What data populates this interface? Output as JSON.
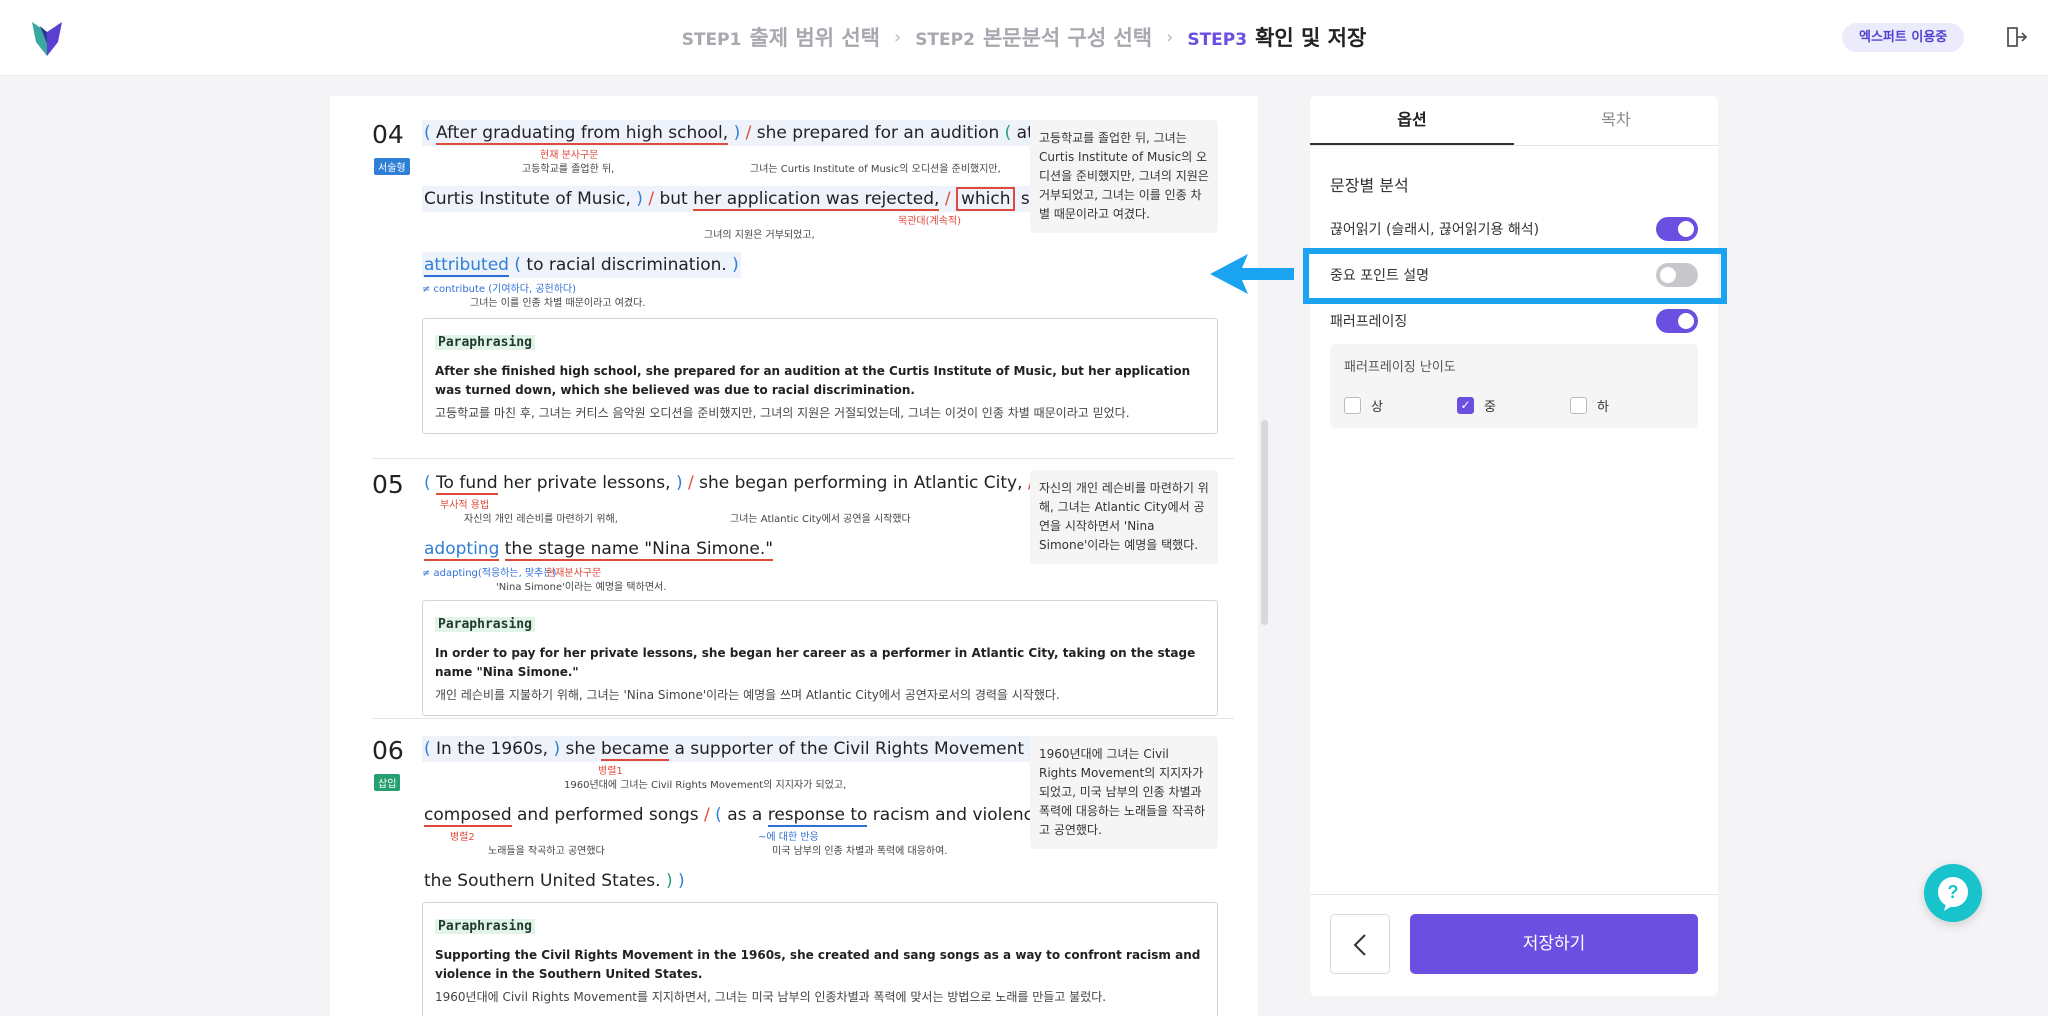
{
  "steps": [
    {
      "num": "STEP1",
      "name": "출제 범위 선택"
    },
    {
      "num": "STEP2",
      "name": "본문분석 구성 선택"
    },
    {
      "num": "STEP3",
      "name": "확인 및 저장"
    }
  ],
  "header": {
    "badge": "엑스퍼트 이용중"
  },
  "items": {
    "q04": {
      "num": "04",
      "tag": "서술형",
      "l1": {
        "ann_a": "현재 분사구문",
        "ann_b": "고등학교를 졸업한 뒤,",
        "ann_c": "그녀는 Curtis Institute of Music의 오디션을 준비했지만,"
      },
      "l2": {
        "ann_a": "그녀의 지원은 거부되었고,",
        "ann_b": "목관대(계속적)"
      },
      "l3": {
        "ann_a": "≠ contribute (기여하다, 공헌하다)",
        "ann_b": "그녀는 이를 인종 차별 때문이라고 여겼다."
      },
      "trans": "고등학교를 졸업한 뒤, 그녀는 Curtis Institute of Music의 오디션을 준비했지만, 그녀의 지원은 거부되었고, 그녀는 이를 인종 차별 때문이라고 여겼다.",
      "para_label": "Paraphrasing",
      "para_en": "After she finished high school, she prepared for an audition at the Curtis Institute of Music, but her application was turned down, which she believed was due to racial discrimination.",
      "para_ko": "고등학교를 마친 후, 그녀는 커티스 음악원 오디션을 준비했지만, 그녀의 지원은 거절되었는데, 그녀는 이것이 인종 차별 때문이라고 믿었다."
    },
    "q05": {
      "num": "05",
      "l1": {
        "ann_a": "부사적 용법",
        "ann_b": "자신의 개인 레슨비를 마련하기 위해,",
        "ann_c": "그녀는 Atlantic City에서 공연을 시작했다"
      },
      "l2": {
        "ann_a": "≠ adapting(적응하는, 맞추는)",
        "ann_b": "현재분사구문",
        "ann_c": "'Nina Simone'이라는 예명을 택하면서."
      },
      "trans": "자신의 개인 레슨비를 마련하기 위해, 그녀는 Atlantic City에서 공연을 시작하면서 'Nina Simone'이라는 예명을 택했다.",
      "para_label": "Paraphrasing",
      "para_en": "In order to pay for her private lessons, she began her career as a performer in Atlantic City, taking on the stage name \"Nina Simone.\"",
      "para_ko": "개인 레슨비를 지불하기 위해, 그녀는 'Nina Simone'이라는 예명을 쓰며 Atlantic City에서 공연자로서의 경력을 시작했다."
    },
    "q06": {
      "num": "06",
      "tag": "삽입",
      "l1": {
        "ann_a": "병렬1",
        "ann_b": "1960년대에 그녀는 Civil Rights Movement의 지지자가 되었고,"
      },
      "l2": {
        "ann_a": "병렬2",
        "ann_b": "노래들을 작곡하고 공연했다",
        "ann_c": "~에 대한 반응",
        "ann_d": "미국 남부의 인종 차별과 폭력에 대응하여."
      },
      "trans": "1960년대에 그녀는 Civil Rights Movement의 지지자가 되었고, 미국 남부의 인종 차별과 폭력에 대응하는 노래들을 작곡하고 공연했다.",
      "para_label": "Paraphrasing",
      "para_en": "Supporting the Civil Rights Movement in the 1960s, she created and sang songs as a way to confront racism and violence in the Southern United States.",
      "para_ko": "1960년대에 Civil Rights Movement를 지지하면서, 그녀는 미국 남부의 인종차별과 폭력에 맞서는 방법으로 노래를 만들고 불렀다."
    }
  },
  "panel": {
    "tabs": [
      "옵션",
      "목차"
    ],
    "section_title": "문장별 분석",
    "options": [
      {
        "label": "끊어읽기 (슬래시, 끊어읽기용 해석)",
        "on": true
      },
      {
        "label": "중요 포인트 설명",
        "on": false
      },
      {
        "label": "패러프레이징",
        "on": true
      }
    ],
    "difficulty": {
      "title": "패러프레이징 난이도",
      "levels": [
        {
          "label": "상",
          "checked": false
        },
        {
          "label": "중",
          "checked": true
        },
        {
          "label": "하",
          "checked": false
        }
      ]
    },
    "save_label": "저장하기"
  },
  "colors": {
    "accent": "#6a4fe0",
    "highlight": "#1aa3f0",
    "annotation_red": "#e04a3c",
    "annotation_blue": "#2f7fd6"
  },
  "icons": [
    "logo-icon",
    "exit-icon",
    "arrow-left-icon",
    "chevron-left-icon",
    "help-chat-icon",
    "check-icon"
  ]
}
